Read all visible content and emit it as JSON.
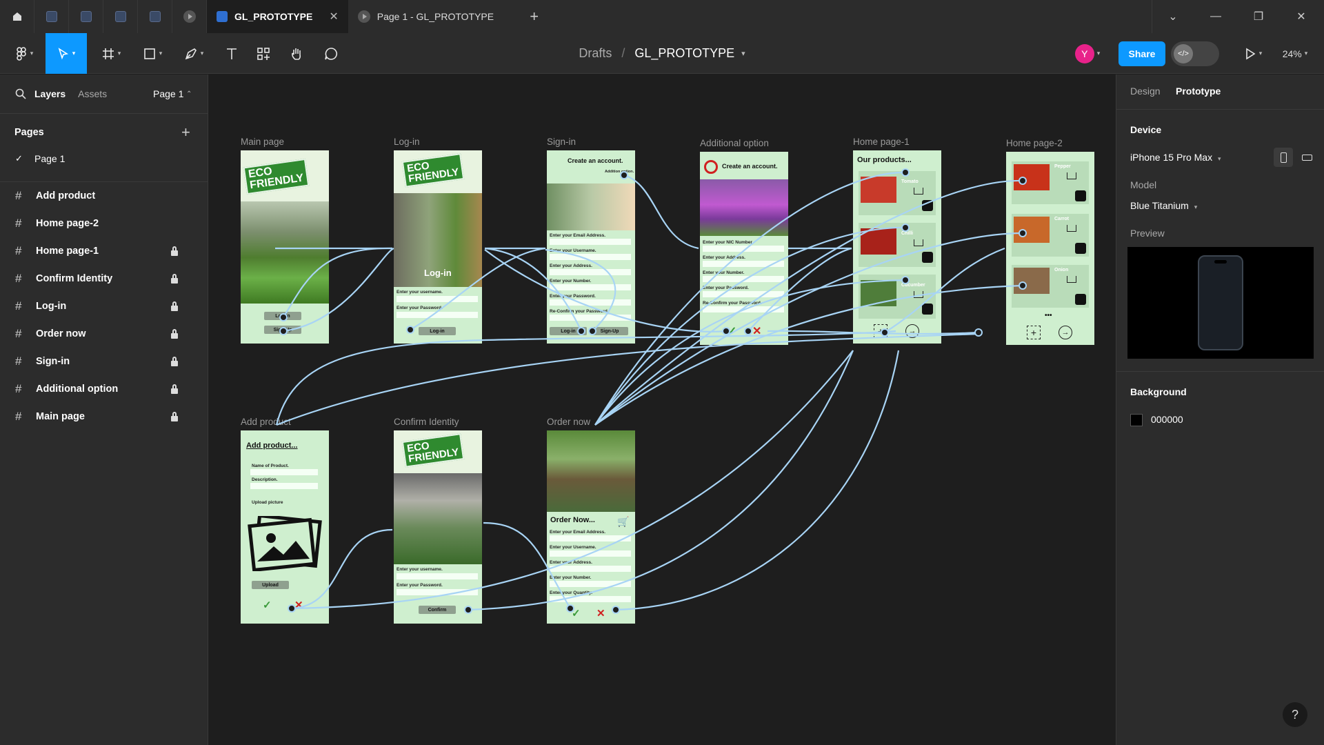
{
  "titlebar": {
    "tabs": [
      {
        "label": "GL_PROTOTYPE",
        "active": true
      },
      {
        "label": "Page 1 - GL_PROTOTYPE",
        "active": false
      }
    ]
  },
  "toolbar": {
    "breadcrumb_drafts": "Drafts",
    "breadcrumb_sep": "/",
    "file_name": "GL_PROTOTYPE",
    "avatar_initial": "Y",
    "share_label": "Share",
    "zoom": "24%"
  },
  "leftpanel": {
    "tab_layers": "Layers",
    "tab_assets": "Assets",
    "page_selector": "Page 1",
    "pages_heading": "Pages",
    "current_page": "Page 1",
    "layers": [
      {
        "name": "Add product",
        "locked": false
      },
      {
        "name": "Home page-2",
        "locked": false
      },
      {
        "name": "Home page-1",
        "locked": true
      },
      {
        "name": "Confirm Identity",
        "locked": true
      },
      {
        "name": "Log-in",
        "locked": true
      },
      {
        "name": "Order now",
        "locked": true
      },
      {
        "name": "Sign-in",
        "locked": true
      },
      {
        "name": "Additional option",
        "locked": true
      },
      {
        "name": "Main page",
        "locked": true
      }
    ]
  },
  "canvas": {
    "frames": {
      "main": {
        "label": "Main page",
        "eco": "ECO\nFRIENDLY",
        "btn_login": "Log-in",
        "btn_signup": "Sign-Up"
      },
      "login": {
        "label": "Log-in",
        "eco": "ECO\nFRIENDLY",
        "heading": "Log-in",
        "f1": "Enter your username.",
        "f2": "Enter your Password.",
        "btn": "Log-in"
      },
      "signin": {
        "label": "Sign-in",
        "heading": "Create an account.",
        "addl": "Addition option.",
        "f1": "Enter your Email Address.",
        "f2": "Enter your Username.",
        "f3": "Enter your Address.",
        "f4": "Enter your Number.",
        "f5": "Enter your Password.",
        "f6": "Re-Confirm your Password.",
        "btn1": "Log-in",
        "btn2": "Sign-Up"
      },
      "addl": {
        "label": "Additional option",
        "heading": "Create an account.",
        "f1": "Enter your NIC Number.",
        "f2": "Enter your Address.",
        "f3": "Enter your Number.",
        "f4": "Enter your Password.",
        "f5": "Re-Confirm your Password."
      },
      "home1": {
        "label": "Home page-1",
        "heading": "Our products...",
        "p1": "Tomato",
        "p2": "Chilli",
        "p3": "Cucumber"
      },
      "home2": {
        "label": "Home page-2",
        "p1": "Pepper",
        "p2": "Carrot",
        "p3": "Onion",
        "more": "•••"
      },
      "addprod": {
        "label": "Add product",
        "heading": "Add product...",
        "f1": "Name of Product.",
        "f2": "Description.",
        "f3": "Upload picture",
        "btn": "Upload"
      },
      "confirm": {
        "label": "Confirm Identity",
        "eco": "ECO\nFRIENDLY",
        "f1": "Enter your username.",
        "f2": "Enter your Password.",
        "btn": "Confirm"
      },
      "order": {
        "label": "Order now",
        "heading": "Order Now...",
        "f1": "Enter your Email Address.",
        "f2": "Enter your Username.",
        "f3": "Enter your Address.",
        "f4": "Enter your Number.",
        "f5": "Enter your Quantity."
      }
    }
  },
  "rightpanel": {
    "tab_design": "Design",
    "tab_prototype": "Prototype",
    "device_heading": "Device",
    "device_value": "iPhone 15 Pro Max",
    "model_label": "Model",
    "model_value": "Blue Titanium",
    "preview_label": "Preview",
    "background_heading": "Background",
    "background_value": "000000"
  },
  "colors": {
    "accent": "#0d99ff",
    "wire": "#a8d4f5",
    "frame_bg": "#cfefcf",
    "avatar": "#e8228a"
  }
}
